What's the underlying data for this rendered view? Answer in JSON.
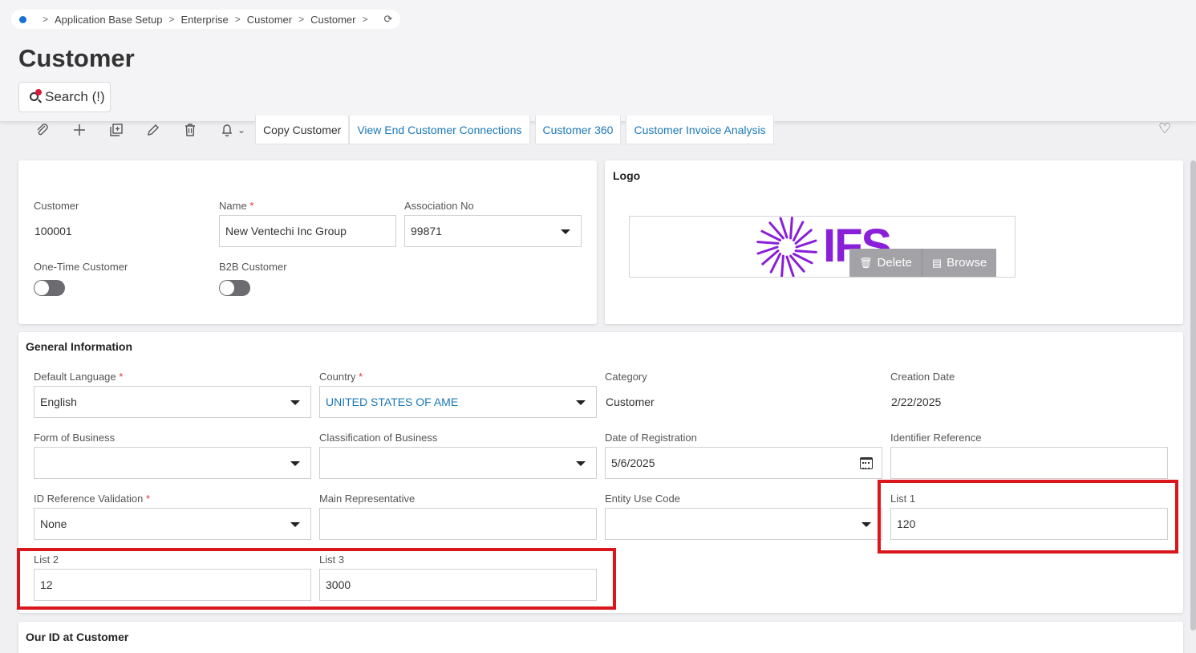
{
  "breadcrumb": {
    "items": [
      "Application Base Setup",
      "Enterprise",
      "Customer",
      "Customer"
    ],
    "separator": ">",
    "refresh_icon": "refresh-icon"
  },
  "page": {
    "title": "Customer",
    "search_label": "Search (!)"
  },
  "toolbar": {
    "icons": [
      "paperclip-icon",
      "plus-icon",
      "duplicate-icon",
      "pencil-icon",
      "trash-icon",
      "bell-icon"
    ],
    "commands": [
      "Copy Customer",
      "View End Customer Connections",
      "Customer 360",
      "Customer Invoice Analysis"
    ],
    "favorite_icon": "heart-icon"
  },
  "header_card": {
    "customer_label": "Customer",
    "customer_value": "100001",
    "name_label": "Name",
    "name_value": "New Ventechi Inc Group",
    "association_label": "Association No",
    "association_value": "99871",
    "one_time_label": "One-Time Customer",
    "b2b_label": "B2B Customer",
    "required_marker": "*"
  },
  "logo_card": {
    "title": "Logo",
    "logo_text": "IFS",
    "delete_label": "Delete",
    "browse_label": "Browse"
  },
  "general": {
    "title": "General Information",
    "default_language_label": "Default Language",
    "default_language_value": "English",
    "country_label": "Country",
    "country_value": "UNITED STATES OF AME",
    "category_label": "Category",
    "category_value": "Customer",
    "creation_date_label": "Creation Date",
    "creation_date_value": "2/22/2025",
    "form_of_business_label": "Form of Business",
    "classification_label": "Classification of Business",
    "date_of_registration_label": "Date of Registration",
    "date_of_registration_value": "5/6/2025",
    "identifier_reference_label": "Identifier Reference",
    "id_ref_validation_label": "ID Reference Validation",
    "id_ref_validation_value": "None",
    "main_rep_label": "Main Representative",
    "entity_use_code_label": "Entity Use Code",
    "list1_label": "List 1",
    "list1_value": "120",
    "list2_label": "List 2",
    "list2_value": "12",
    "list3_label": "List 3",
    "list3_value": "3000"
  },
  "our_id": {
    "title": "Our ID at Customer"
  },
  "colors": {
    "link": "#1a78b8",
    "highlight": "#d9161c",
    "brand_logo": "#8a1fd8",
    "required": "#d9363e"
  }
}
